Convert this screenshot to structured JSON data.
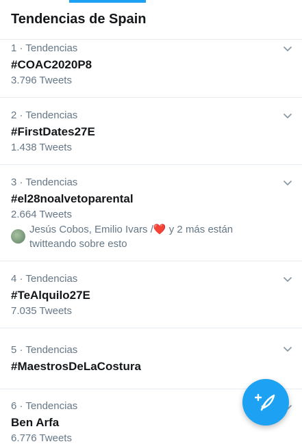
{
  "header": {
    "title": "Tendencias de Spain"
  },
  "trends": [
    {
      "meta": "1 · Tendencias",
      "name": "#COAC2020P8",
      "count": "3.796 Tweets"
    },
    {
      "meta": "2 · Tendencias",
      "name": "#FirstDates27E",
      "count": "1.438 Tweets"
    },
    {
      "meta": "3 · Tendencias",
      "name": "#el28noalvetoparental",
      "count": "2.664 Tweets",
      "context_names": "Jesús Cobos, Emilio Ivars /",
      "context_heart": "❤️",
      "context_rest": " y 2 más están twitteando sobre esto"
    },
    {
      "meta": "4 · Tendencias",
      "name": "#TeAlquilo27E",
      "count": "7.035 Tweets"
    },
    {
      "meta": "5 · Tendencias",
      "name": "#MaestrosDeLaCostura"
    },
    {
      "meta": "6 · Tendencias",
      "name": "Ben Arfa",
      "count": "6.776 Tweets"
    }
  ],
  "icons": {
    "more": "chevron-down-icon",
    "compose": "compose-tweet-icon"
  },
  "colors": {
    "accent": "#1da1f2",
    "secondary_text": "#657786",
    "heart": "#e0245e"
  }
}
